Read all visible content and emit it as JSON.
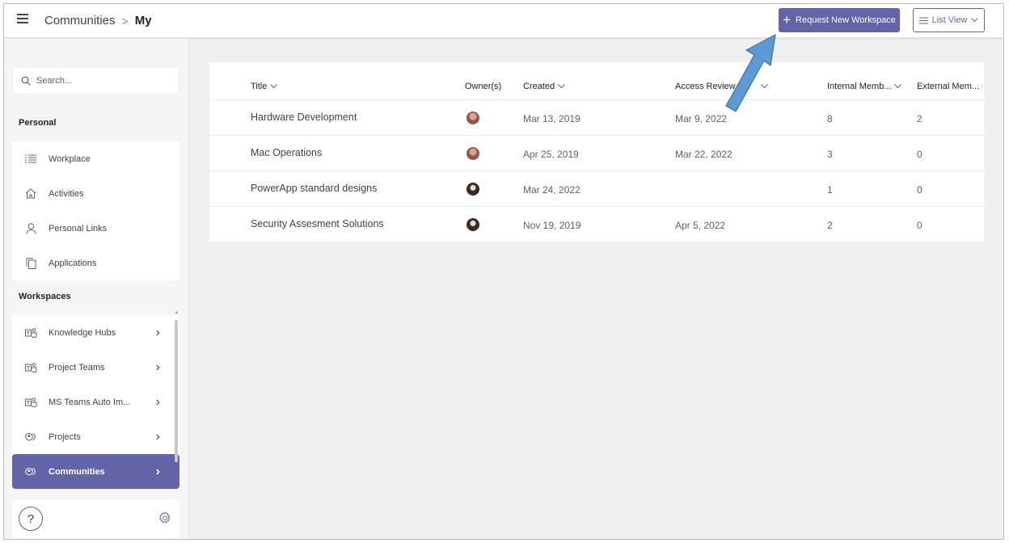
{
  "header": {
    "breadcrumb_root": "Communities",
    "breadcrumb_separator": ">",
    "breadcrumb_current": "My",
    "request_button_label": "Request New Workspace",
    "view_button_label": "List View"
  },
  "sidebar": {
    "search_placeholder": "Search...",
    "personal_label": "Personal",
    "personal_items": [
      {
        "label": "Workplace",
        "icon": "list-icon"
      },
      {
        "label": "Activities",
        "icon": "home-icon"
      },
      {
        "label": "Personal Links",
        "icon": "person-icon"
      },
      {
        "label": "Applications",
        "icon": "copy-icon"
      }
    ],
    "workspaces_label": "Workspaces",
    "workspace_items": [
      {
        "label": "Knowledge Hubs",
        "icon": "teams-icon"
      },
      {
        "label": "Project Teams",
        "icon": "teams-icon"
      },
      {
        "label": "MS Teams Auto Im...",
        "icon": "teams-icon"
      },
      {
        "label": "Projects",
        "icon": "group-icon"
      },
      {
        "label": "Communities",
        "icon": "group-icon",
        "active": true
      }
    ],
    "help_label": "?"
  },
  "table": {
    "columns": [
      "Title",
      "Owner(s)",
      "Created",
      "Access Review d",
      "Internal Memb...",
      "External Mem..."
    ],
    "rows": [
      {
        "title": "Hardware Development",
        "created": "Mar 13, 2019",
        "access_review": "Mar 9, 2022",
        "internal": "8",
        "external": "2"
      },
      {
        "title": "Mac Operations",
        "created": "Apr 25, 2019",
        "access_review": "Mar 22, 2022",
        "internal": "3",
        "external": "0"
      },
      {
        "title": "PowerApp standard designs",
        "created": "Mar 24, 2022",
        "access_review": "",
        "internal": "1",
        "external": "0"
      },
      {
        "title": "Security Assesment Solutions",
        "created": "Nov 19, 2019",
        "access_review": "Apr 5, 2022",
        "internal": "2",
        "external": "0"
      }
    ]
  },
  "colors": {
    "accent": "#6264a7",
    "callout_arrow": "#5b9bd5"
  }
}
